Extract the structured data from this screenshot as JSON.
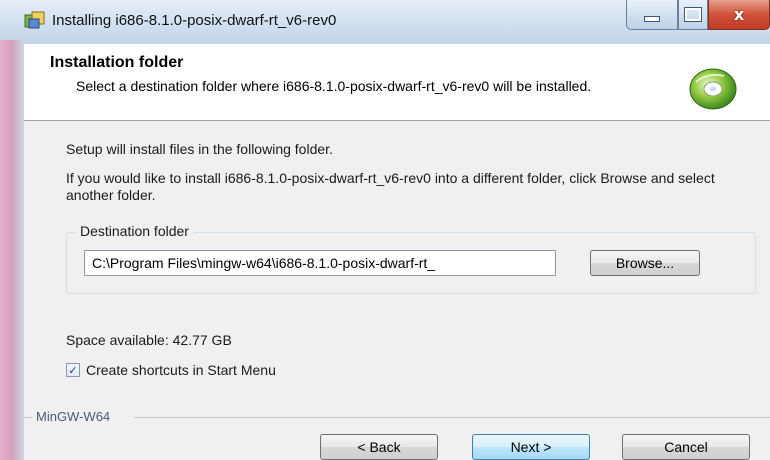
{
  "window": {
    "title": "Installing i686-8.1.0-posix-dwarf-rt_v6-rev0",
    "close_glyph": "x"
  },
  "header": {
    "title": "Installation folder",
    "subtitle": "Select a destination folder where i686-8.1.0-posix-dwarf-rt_v6-rev0 will be installed."
  },
  "body": {
    "info_line": "Setup will install files in the following folder.",
    "instructions": "If you would like to install i686-8.1.0-posix-dwarf-rt_v6-rev0 into a different folder, click Browse and select another folder.",
    "destination_group_label": "Destination folder",
    "destination_path": "C:\\Program Files\\mingw-w64\\i686-8.1.0-posix-dwarf-rt_",
    "browse_label": "Browse...",
    "space_available": "Space available: 42.77 GB",
    "shortcut_label": "Create shortcuts in Start Menu",
    "shortcut_checked": true
  },
  "footer": {
    "brand": "MinGW-W64",
    "back_label": "< Back",
    "next_label": "Next >",
    "cancel_label": "Cancel"
  },
  "icons": {
    "title_icon": "installer-icon",
    "header_icon": "cd-disc-icon"
  }
}
